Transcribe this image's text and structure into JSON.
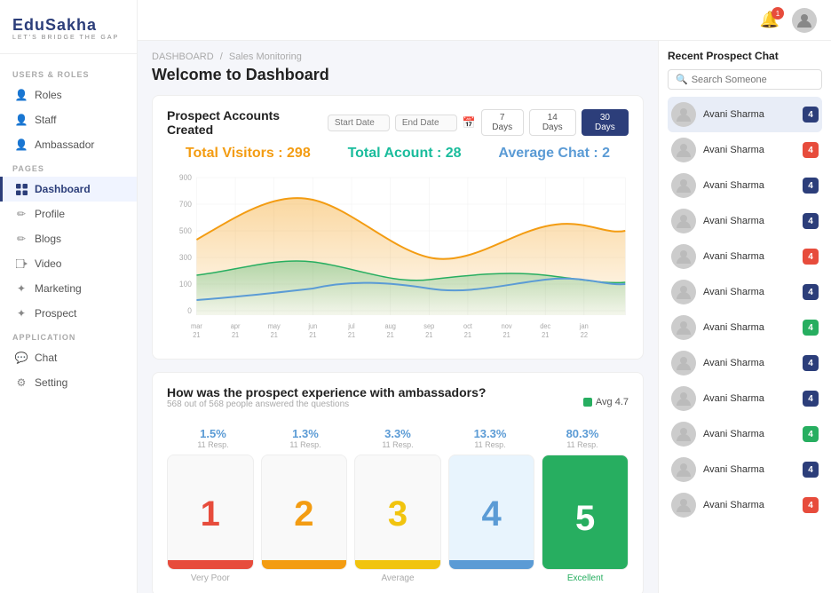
{
  "logo": {
    "text": "EduSakha",
    "sub": "LET'S BRIDGE THE GAP"
  },
  "sidebar": {
    "sections": [
      {
        "label": "USERS & ROLES",
        "items": [
          {
            "id": "roles",
            "label": "Roles",
            "icon": "👤"
          },
          {
            "id": "staff",
            "label": "Staff",
            "icon": "👤"
          },
          {
            "id": "ambassador",
            "label": "Ambassador",
            "icon": "👤"
          }
        ]
      },
      {
        "label": "PAGES",
        "items": [
          {
            "id": "dashboard",
            "label": "Dashboard",
            "icon": "▦",
            "active": true
          },
          {
            "id": "profile",
            "label": "Profile",
            "icon": "✏"
          },
          {
            "id": "blogs",
            "label": "Blogs",
            "icon": "✏"
          },
          {
            "id": "video",
            "label": "Video",
            "icon": "▢"
          },
          {
            "id": "marketing",
            "label": "Marketing",
            "icon": "✦"
          },
          {
            "id": "prospect",
            "label": "Prospect",
            "icon": "✦"
          }
        ]
      },
      {
        "label": "APPLICATION",
        "items": [
          {
            "id": "chat",
            "label": "Chat",
            "icon": "💬"
          },
          {
            "id": "setting",
            "label": "Setting",
            "icon": "⚙"
          }
        ]
      }
    ]
  },
  "topbar": {
    "notification_count": "1",
    "avatar_icon": "👤"
  },
  "breadcrumb": {
    "root": "DASHBOARD",
    "separator": "/",
    "current": "Sales Monitoring"
  },
  "page_title": "Welcome to Dashboard",
  "chart_card": {
    "title": "Prospect Accounts Created",
    "date_start_placeholder": "Start Date",
    "date_end_placeholder": "End Date",
    "periods": [
      "7 Days",
      "14 Days",
      "30 Days"
    ],
    "active_period": "30 Days",
    "stats": [
      {
        "label": "Total Visitors",
        "value": "298",
        "color": "orange"
      },
      {
        "label": "Total Acount",
        "value": "28",
        "color": "teal"
      },
      {
        "label": "Average Chat",
        "value": "2",
        "color": "blue"
      }
    ],
    "y_axis": [
      "900",
      "700",
      "500",
      "300",
      "100",
      "0"
    ],
    "x_axis": [
      "mar\n21",
      "apr\n21",
      "may\n21",
      "jun\n21",
      "jul\n21",
      "aug\n21",
      "sep\n21",
      "oct\n21",
      "nov\n21",
      "dec\n21",
      "jan\n22"
    ]
  },
  "experience_card": {
    "title": "How was the prospect experience with ambassadors?",
    "subtitle": "568 out of 568 people answered the questions",
    "avg_label": "Avg 4.7",
    "ratings": [
      {
        "pct": "1.5%",
        "resp": "11 Resp.",
        "number": "1",
        "label": "Very Poor",
        "color_class": "red",
        "footer_class": "footer-red"
      },
      {
        "pct": "1.3%",
        "resp": "11 Resp.",
        "number": "2",
        "label": "",
        "color_class": "orange",
        "footer_class": "footer-orange"
      },
      {
        "pct": "3.3%",
        "resp": "11 Resp.",
        "number": "3",
        "label": "Average",
        "color_class": "yellow",
        "footer_class": "footer-yellow"
      },
      {
        "pct": "13.3%",
        "resp": "11 Resp.",
        "number": "4",
        "label": "",
        "color_class": "blue-num",
        "footer_class": "footer-blue",
        "is_blue_label": true
      },
      {
        "pct": "80.3%",
        "resp": "11 Resp.",
        "number": "5",
        "label": "Excellent",
        "color_class": "white",
        "is_green": true
      }
    ]
  },
  "right_panel": {
    "title": "Recent Prospect Chat",
    "search_placeholder": "Search Someone",
    "chats": [
      {
        "name": "Avani Sharma",
        "badge": "4",
        "badge_color": "badge-navy",
        "active": true
      },
      {
        "name": "Avani Sharma",
        "badge": "4",
        "badge_color": "badge-red"
      },
      {
        "name": "Avani Sharma",
        "badge": "4",
        "badge_color": "badge-navy"
      },
      {
        "name": "Avani Sharma",
        "badge": "4",
        "badge_color": "badge-navy"
      },
      {
        "name": "Avani Sharma",
        "badge": "4",
        "badge_color": "badge-red"
      },
      {
        "name": "Avani Sharma",
        "badge": "4",
        "badge_color": "badge-navy"
      },
      {
        "name": "Avani Sharma",
        "badge": "4",
        "badge_color": "badge-green"
      },
      {
        "name": "Avani Sharma",
        "badge": "4",
        "badge_color": "badge-navy"
      },
      {
        "name": "Avani Sharma",
        "badge": "4",
        "badge_color": "badge-navy"
      },
      {
        "name": "Avani Sharma",
        "badge": "4",
        "badge_color": "badge-green"
      },
      {
        "name": "Avani Sharma",
        "badge": "4",
        "badge_color": "badge-navy"
      },
      {
        "name": "Avani Sharma",
        "badge": "4",
        "badge_color": "badge-red"
      }
    ]
  }
}
